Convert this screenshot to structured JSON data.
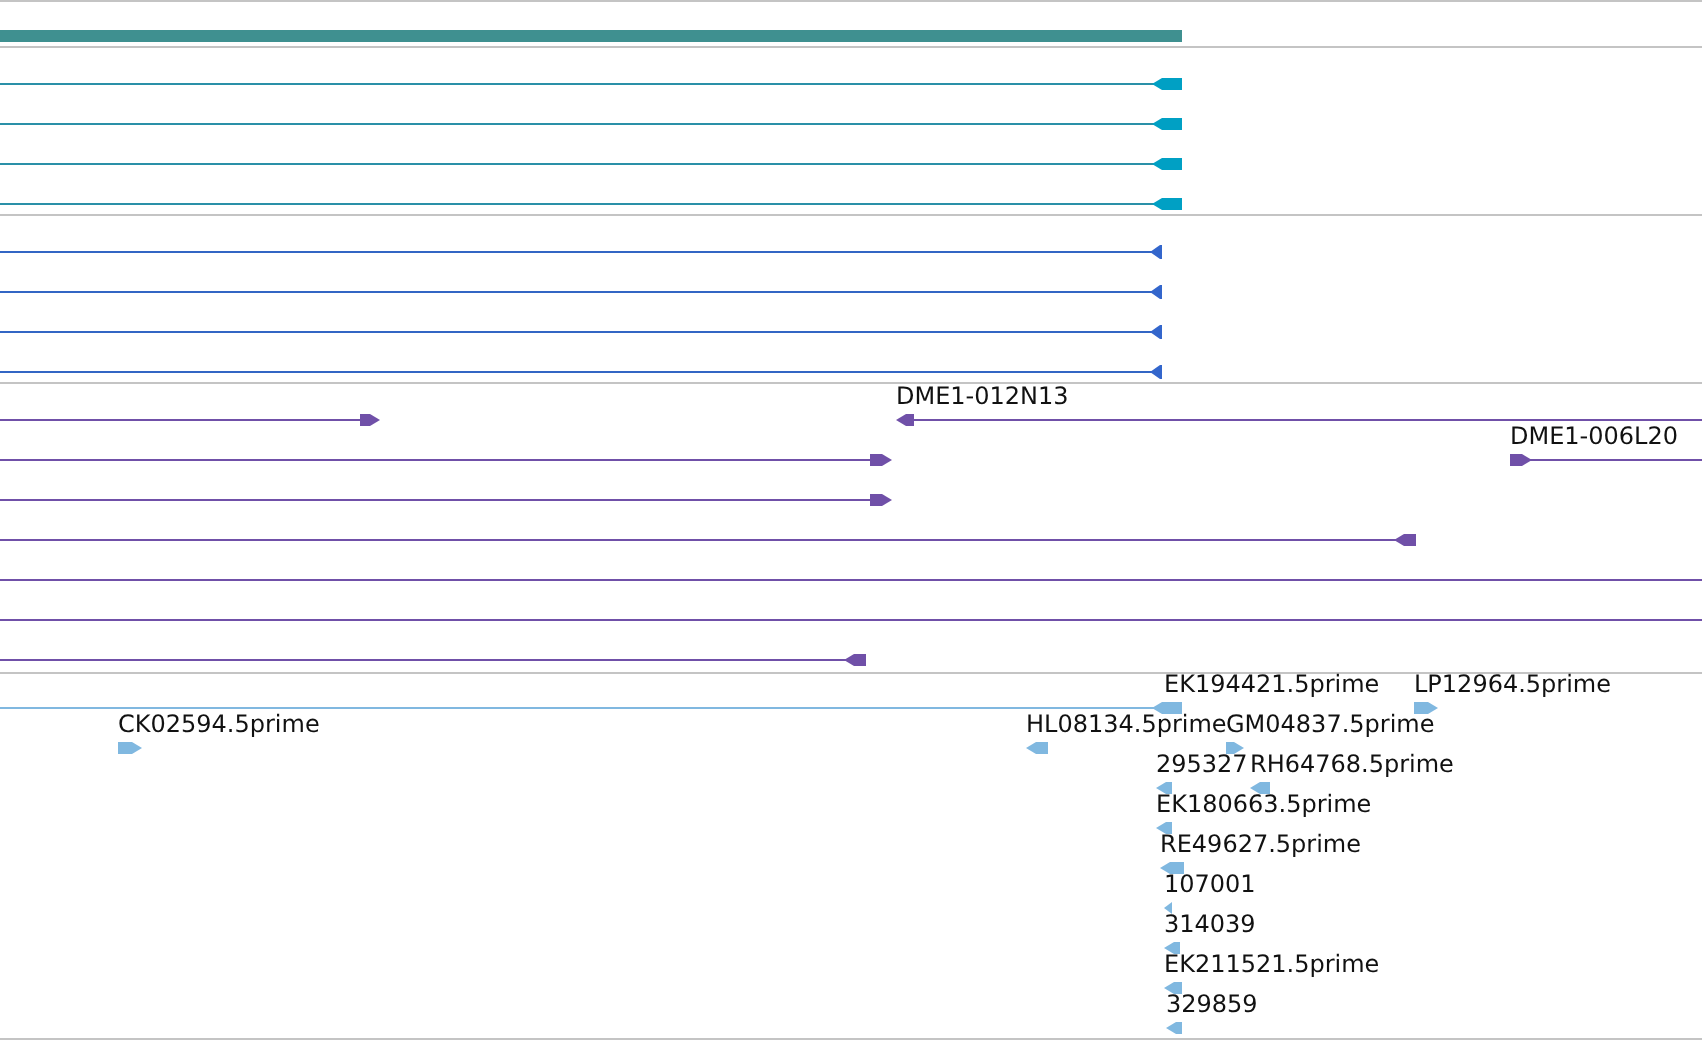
{
  "tracks": [
    {
      "kind": "bar",
      "features": [
        {
          "kind": "plain"
        }
      ]
    },
    {
      "kind": "transcripts",
      "features": [
        {
          "kind": "reverse"
        },
        {
          "kind": "reverse"
        },
        {
          "kind": "reverse"
        },
        {
          "kind": "reverse"
        }
      ]
    },
    {
      "kind": "cds",
      "features": [
        {
          "kind": "reverse"
        },
        {
          "kind": "reverse"
        },
        {
          "kind": "reverse"
        },
        {
          "kind": "reverse"
        }
      ]
    },
    {
      "kind": "clones",
      "features": [
        {
          "kind": "forward"
        },
        {
          "kind": "reverse",
          "label": "DME1-012N13"
        },
        {
          "kind": "forward"
        },
        {
          "kind": "forward",
          "label": "DME1-006L20"
        },
        {
          "kind": "forward"
        },
        {
          "kind": "reverse"
        },
        {
          "kind": "plain"
        },
        {
          "kind": "plain"
        },
        {
          "kind": "reverse"
        }
      ]
    },
    {
      "kind": "ests",
      "features": [
        {
          "kind": "reverse",
          "label": "EK194421.5prime"
        },
        {
          "kind": "forward",
          "label": "LP12964.5prime"
        },
        {
          "kind": "forward",
          "label": "CK02594.5prime"
        },
        {
          "kind": "reverse",
          "label": "HL08134.5prime"
        },
        {
          "kind": "forward",
          "label": "GM04837.5prime"
        },
        {
          "kind": "reverse",
          "label": "295327"
        },
        {
          "kind": "reverse",
          "label": "RH64768.5prime"
        },
        {
          "kind": "reverse",
          "label": "EK180663.5prime"
        },
        {
          "kind": "reverse",
          "label": "RE49627.5prime"
        },
        {
          "kind": "reverse",
          "label": "107001"
        },
        {
          "kind": "reverse",
          "label": "314039"
        },
        {
          "kind": "reverse",
          "label": "EK211521.5prime"
        },
        {
          "kind": "reverse",
          "label": "329859"
        }
      ]
    }
  ]
}
